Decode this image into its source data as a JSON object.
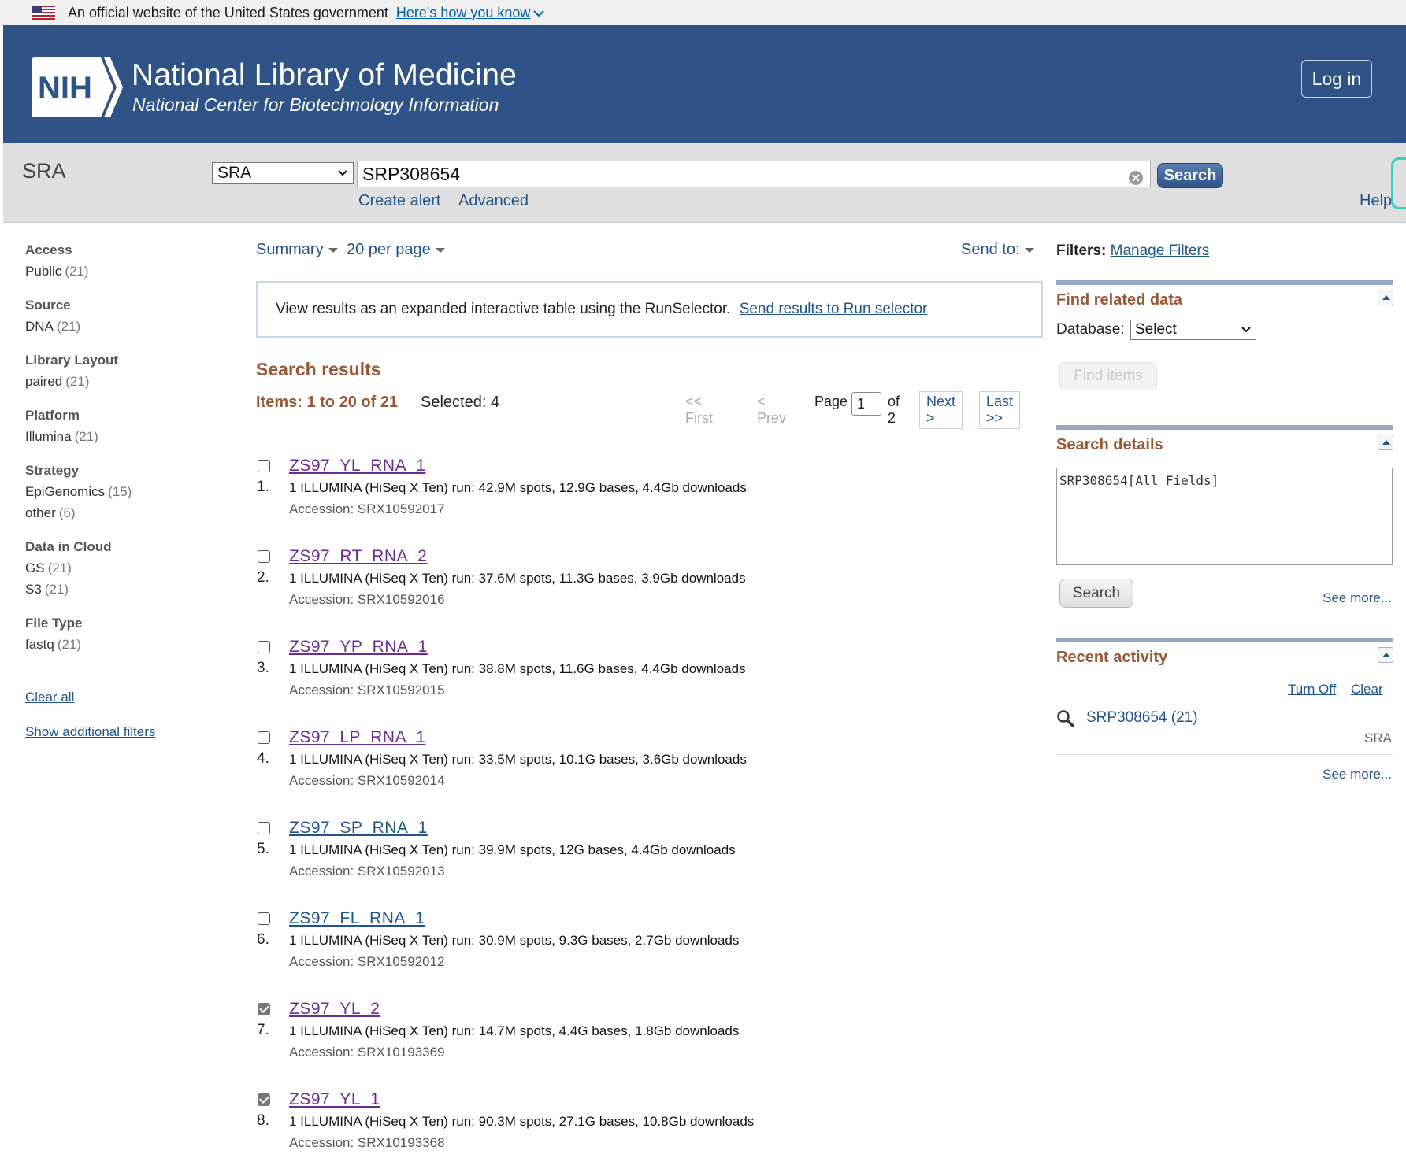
{
  "gov_banner": {
    "official_text": "An official website of the United States government",
    "how_know": "Here's how you know"
  },
  "header": {
    "logo_text": "NIH",
    "title": "National Library of Medicine",
    "subtitle": "National Center for Biotechnology Information",
    "login": "Log in",
    "brand_color": "#2f5386"
  },
  "search": {
    "db_label": "SRA",
    "db_selected": "SRA",
    "term": "SRP308654",
    "search_button": "Search",
    "create_alert": "Create alert",
    "advanced": "Advanced",
    "help": "Help"
  },
  "facets": {
    "groups": [
      {
        "title": "Access",
        "items": [
          {
            "label": "Public",
            "count": "(21)"
          }
        ]
      },
      {
        "title": "Source",
        "items": [
          {
            "label": "DNA",
            "count": "(21)"
          }
        ]
      },
      {
        "title": "Library Layout",
        "items": [
          {
            "label": "paired",
            "count": "(21)"
          }
        ]
      },
      {
        "title": "Platform",
        "items": [
          {
            "label": "Illumina",
            "count": "(21)"
          }
        ]
      },
      {
        "title": "Strategy",
        "items": [
          {
            "label": "EpiGenomics",
            "count": "(15)"
          },
          {
            "label": "other",
            "count": "(6)"
          }
        ]
      },
      {
        "title": "Data in Cloud",
        "items": [
          {
            "label": "GS",
            "count": "(21)"
          },
          {
            "label": "S3",
            "count": "(21)"
          }
        ]
      },
      {
        "title": "File Type",
        "items": [
          {
            "label": "fastq",
            "count": "(21)"
          }
        ]
      }
    ],
    "clear_all": "Clear all",
    "show_additional": "Show additional filters"
  },
  "display": {
    "format": "Summary",
    "per_page": "20 per page",
    "send_to": "Send to:"
  },
  "runselector": {
    "text": "View results as an expanded interactive table using the RunSelector.",
    "link": "Send results to Run selector"
  },
  "results": {
    "heading": "Search results",
    "items_label": "Items: 1 to 20 of 21",
    "selected_label": "Selected: 4",
    "pager": {
      "first": "<< First",
      "prev": "< Prev",
      "page_label": "Page",
      "page_value": "1",
      "of_label": "of 2",
      "next": "Next >",
      "last": "Last >>"
    },
    "items": [
      {
        "num": "1.",
        "title": "ZS97_YL_RNA_1",
        "desc": "1 ILLUMINA (HiSeq X Ten) run: 42.9M spots, 12.9G bases, 4.4Gb downloads",
        "accession": "Accession: SRX10592017",
        "checked": false,
        "visited": true
      },
      {
        "num": "2.",
        "title": "ZS97_RT_RNA_2",
        "desc": "1 ILLUMINA (HiSeq X Ten) run: 37.6M spots, 11.3G bases, 3.9Gb downloads",
        "accession": "Accession: SRX10592016",
        "checked": false,
        "visited": true
      },
      {
        "num": "3.",
        "title": "ZS97_YP_RNA_1",
        "desc": "1 ILLUMINA (HiSeq X Ten) run: 38.8M spots, 11.6G bases, 4.4Gb downloads",
        "accession": "Accession: SRX10592015",
        "checked": false,
        "visited": true
      },
      {
        "num": "4.",
        "title": "ZS97_LP_RNA_1",
        "desc": "1 ILLUMINA (HiSeq X Ten) run: 33.5M spots, 10.1G bases, 3.6Gb downloads",
        "accession": "Accession: SRX10592014",
        "checked": false,
        "visited": true
      },
      {
        "num": "5.",
        "title": "ZS97_SP_RNA_1",
        "desc": "1 ILLUMINA (HiSeq X Ten) run: 39.9M spots, 12G bases, 4.4Gb downloads",
        "accession": "Accession: SRX10592013",
        "checked": false,
        "visited": false
      },
      {
        "num": "6.",
        "title": "ZS97_FL_RNA_1",
        "desc": "1 ILLUMINA (HiSeq X Ten) run: 30.9M spots, 9.3G bases, 2.7Gb downloads",
        "accession": "Accession: SRX10592012",
        "checked": false,
        "visited": false
      },
      {
        "num": "7.",
        "title": "ZS97_YL_2",
        "desc": "1 ILLUMINA (HiSeq X Ten) run: 14.7M spots, 4.4G bases, 1.8Gb downloads",
        "accession": "Accession: SRX10193369",
        "checked": true,
        "visited": true
      },
      {
        "num": "8.",
        "title": "ZS97_YL_1",
        "desc": "1 ILLUMINA (HiSeq X Ten) run: 90.3M spots, 27.1G bases, 10.8Gb downloads",
        "accession": "Accession: SRX10193368",
        "checked": true,
        "visited": true
      }
    ]
  },
  "sidebar": {
    "filters_label": "Filters:",
    "manage_filters": "Manage Filters",
    "related": {
      "title": "Find related data",
      "db_label": "Database:",
      "db_selected": "Select",
      "find_items": "Find items"
    },
    "details": {
      "title": "Search details",
      "query": "SRP308654[All Fields]",
      "search_button": "Search",
      "see_more": "See more..."
    },
    "activity": {
      "title": "Recent activity",
      "turn_off": "Turn Off",
      "clear": "Clear",
      "item": "SRP308654 (21)",
      "item_db": "SRA",
      "see_more": "See more..."
    }
  }
}
